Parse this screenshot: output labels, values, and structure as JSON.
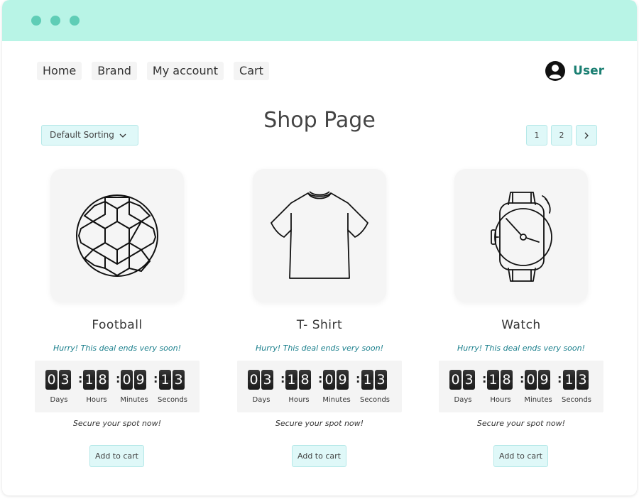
{
  "window": {
    "titlebar_color": "#b8f4e6",
    "dot_color": "#5fcdb6"
  },
  "nav": {
    "items": [
      {
        "label": "Home"
      },
      {
        "label": "Brand"
      },
      {
        "label": "My account"
      },
      {
        "label": "Cart"
      }
    ]
  },
  "user": {
    "label": "User",
    "icon": "user-circle-icon",
    "color": "#1a7f72"
  },
  "page": {
    "title": "Shop Page"
  },
  "sort": {
    "label": "Default Sorting",
    "icon": "chevron-down-icon"
  },
  "pagination": {
    "pages": [
      "1",
      "2"
    ],
    "next_icon": "chevron-right-icon"
  },
  "timer_labels": {
    "days": "Days",
    "hours": "Hours",
    "minutes": "Minutes",
    "seconds": "Seconds"
  },
  "products": [
    {
      "name": "Football",
      "icon": "football-icon",
      "hurry": "Hurry! This deal ends very soon!",
      "countdown": {
        "days": [
          "0",
          "3"
        ],
        "hours": [
          "1",
          "8"
        ],
        "minutes": [
          "0",
          "9"
        ],
        "seconds": [
          "1",
          "3"
        ]
      },
      "secure": "Secure your spot now!",
      "button": "Add to cart"
    },
    {
      "name": "T- Shirt",
      "icon": "t-shirt-icon",
      "hurry": "Hurry! This deal ends very soon!",
      "countdown": {
        "days": [
          "0",
          "3"
        ],
        "hours": [
          "1",
          "8"
        ],
        "minutes": [
          "0",
          "9"
        ],
        "seconds": [
          "1",
          "3"
        ]
      },
      "secure": "Secure your spot now!",
      "button": "Add to cart"
    },
    {
      "name": "Watch",
      "icon": "watch-icon",
      "hurry": "Hurry! This deal ends very soon!",
      "countdown": {
        "days": [
          "0",
          "3"
        ],
        "hours": [
          "1",
          "8"
        ],
        "minutes": [
          "0",
          "9"
        ],
        "seconds": [
          "1",
          "3"
        ]
      },
      "secure": "Secure your spot now!",
      "button": "Add to cart"
    }
  ]
}
